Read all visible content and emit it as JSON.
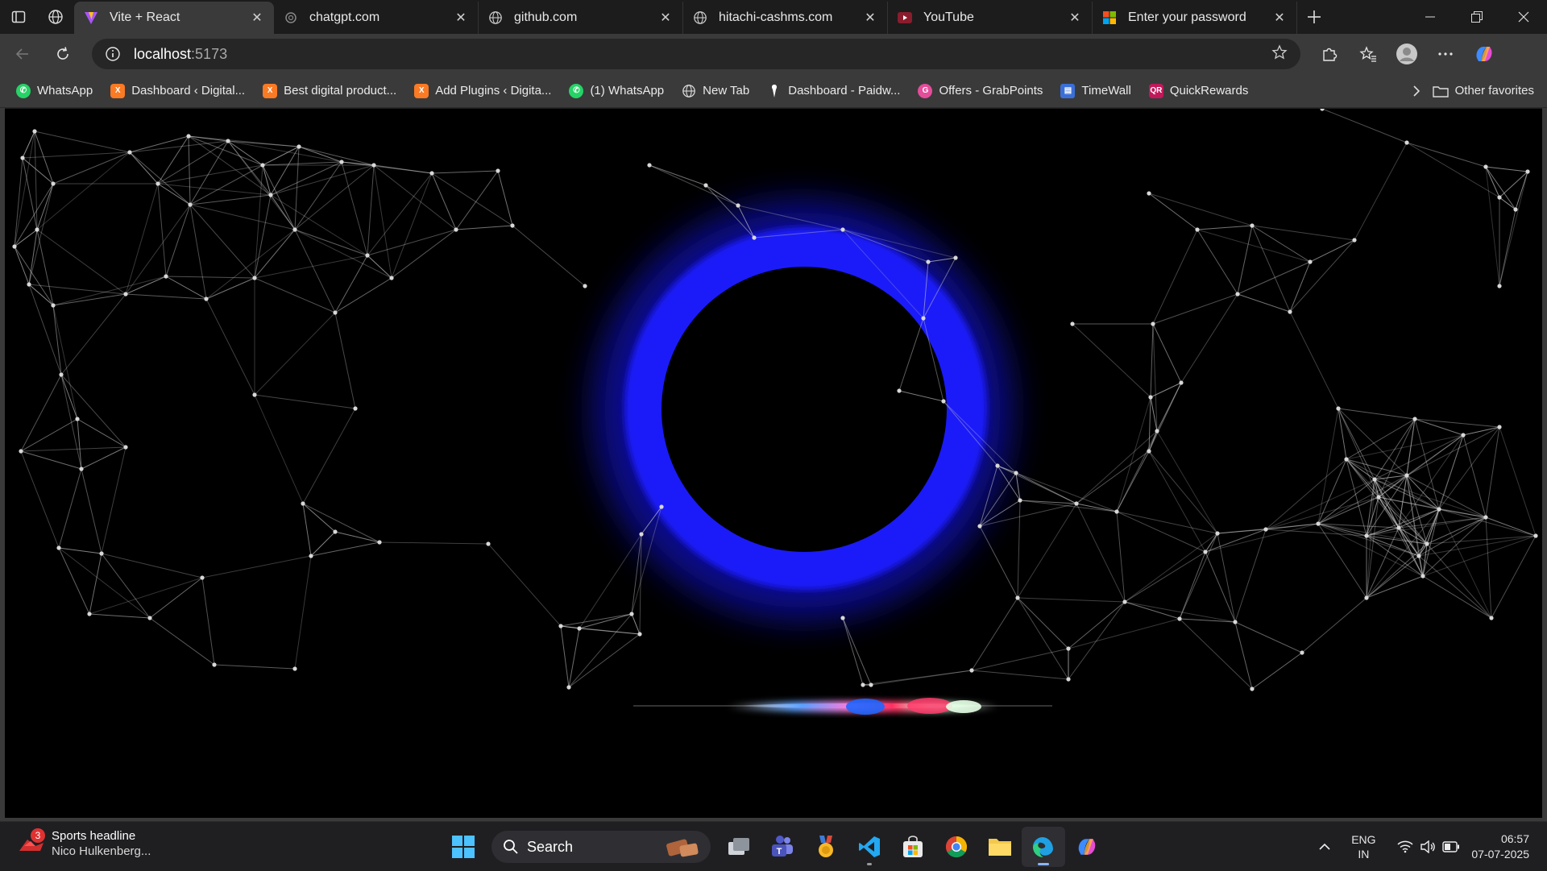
{
  "browser": {
    "tabs": [
      {
        "title": "Vite + React",
        "active": true,
        "icon": "vite-icon"
      },
      {
        "title": "chatgpt.com",
        "active": false,
        "icon": "openai-icon"
      },
      {
        "title": "github.com",
        "active": false,
        "icon": "globe-icon"
      },
      {
        "title": "hitachi-cashms.com",
        "active": false,
        "icon": "globe-icon"
      },
      {
        "title": "YouTube",
        "active": false,
        "icon": "youtube-icon"
      },
      {
        "title": "Enter your password",
        "active": false,
        "icon": "microsoft-icon"
      }
    ],
    "address": {
      "host": "localhost",
      "port": ":5173"
    },
    "bookmarks": [
      {
        "label": "WhatsApp",
        "icon": "whatsapp-icon",
        "color": "#25d366"
      },
      {
        "label": "Dashboard ‹ Digital...",
        "icon": "xampp-icon",
        "color": "#fb7a24"
      },
      {
        "label": "Best digital product...",
        "icon": "xampp-icon",
        "color": "#fb7a24"
      },
      {
        "label": "Add Plugins ‹ Digita...",
        "icon": "xampp-icon",
        "color": "#fb7a24"
      },
      {
        "label": "(1) WhatsApp",
        "icon": "whatsapp-icon",
        "color": "#25d366"
      },
      {
        "label": "New Tab",
        "icon": "globe-icon",
        "color": "#cccccc"
      },
      {
        "label": "Dashboard - Paidw...",
        "icon": "pin-icon",
        "color": "#ffffff"
      },
      {
        "label": "Offers - GrabPoints",
        "icon": "grabpoints-icon",
        "color": "#e44d9a"
      },
      {
        "label": "TimeWall",
        "icon": "timewall-icon",
        "color": "#3b6fd8"
      },
      {
        "label": "QuickRewards",
        "icon": "quickrewards-icon",
        "color": "#c2185b"
      }
    ],
    "other_favorites": "Other favorites"
  },
  "taskbar": {
    "widget": {
      "badge": "3",
      "headline": "Sports headline",
      "subtitle": "Nico Hulkenberg..."
    },
    "search_label": "Search",
    "apps": [
      "start-icon",
      "search",
      "task-view-icon",
      "teams-icon",
      "medal-app-icon",
      "vscode-icon",
      "store-icon",
      "chrome-icon",
      "file-explorer-icon",
      "edge-icon",
      "copilot-icon"
    ],
    "lang": {
      "line1": "ENG",
      "line2": "IN"
    },
    "time": "06:57",
    "date": "07-07-2025"
  },
  "colors": {
    "ring": "#1a1aff",
    "background": "#000000",
    "network_lines": "#bfbfbf"
  }
}
